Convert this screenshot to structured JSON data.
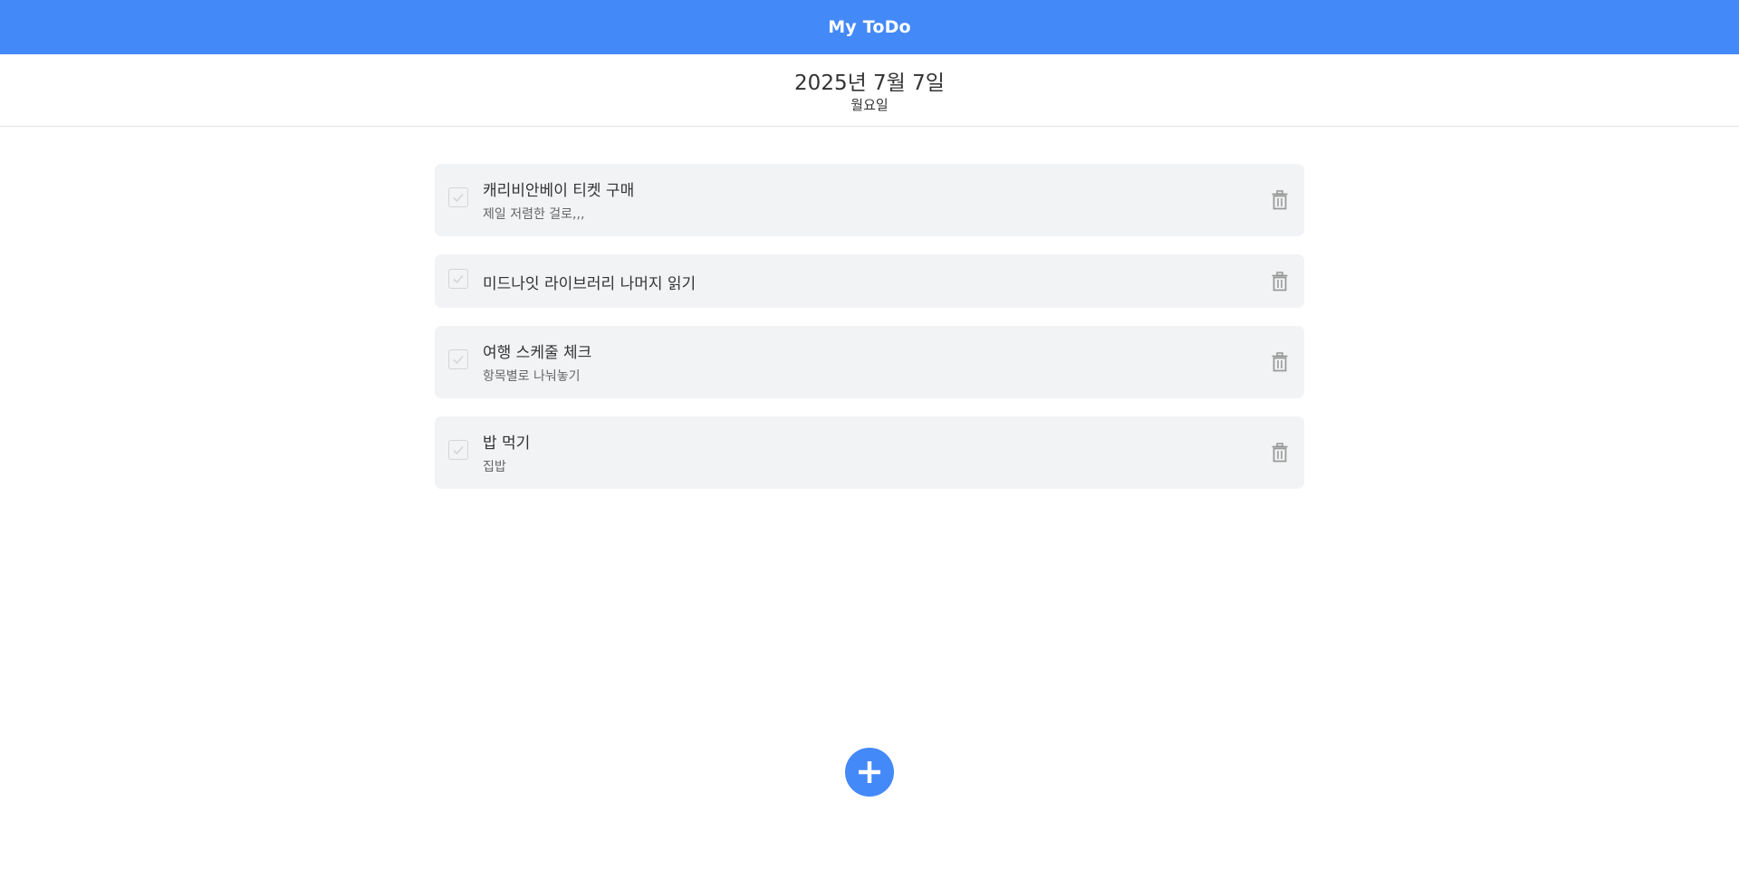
{
  "app": {
    "title": "My ToDo"
  },
  "date": {
    "full": "2025년 7월 7일",
    "weekday": "월요일"
  },
  "todos": [
    {
      "title": "캐리비안베이 티켓 구매",
      "description": "제일 저렴한 걸로,,,",
      "completed": false
    },
    {
      "title": "미드나잇 라이브러리 나머지 읽기",
      "description": "",
      "completed": false
    },
    {
      "title": "여행 스케줄 체크",
      "description": "항목별로 나눠놓기",
      "completed": false
    },
    {
      "title": "밥 먹기",
      "description": "집밥",
      "completed": false
    }
  ],
  "colors": {
    "accent": "#4489f8",
    "item_background": "#f2f3f5",
    "icon_gray": "#9a9a9a"
  },
  "icons": {
    "checkbox": "check-icon",
    "delete": "trash-icon",
    "add": "plus-icon"
  }
}
